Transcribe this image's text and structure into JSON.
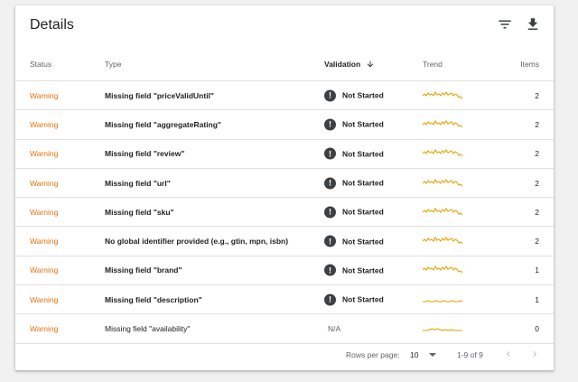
{
  "card": {
    "title": "Details",
    "filter_icon": "filter-icon",
    "download_icon": "download-icon"
  },
  "table": {
    "headers": {
      "status": "Status",
      "type": "Type",
      "validation": "Validation",
      "trend": "Trend",
      "items": "Items"
    },
    "rows": [
      {
        "status": "Warning",
        "type": "Missing field \"priceValidUntil\"",
        "validation": "Not Started",
        "items": "2"
      },
      {
        "status": "Warning",
        "type": "Missing field \"aggregateRating\"",
        "validation": "Not Started",
        "items": "2"
      },
      {
        "status": "Warning",
        "type": "Missing field \"review\"",
        "validation": "Not Started",
        "items": "2"
      },
      {
        "status": "Warning",
        "type": "Missing field \"url\"",
        "validation": "Not Started",
        "items": "2"
      },
      {
        "status": "Warning",
        "type": "Missing field \"sku\"",
        "validation": "Not Started",
        "items": "2"
      },
      {
        "status": "Warning",
        "type": "No global identifier provided (e.g., gtin, mpn, isbn)",
        "validation": "Not Started",
        "items": "2"
      },
      {
        "status": "Warning",
        "type": "Missing field \"brand\"",
        "validation": "Not Started",
        "items": "1"
      },
      {
        "status": "Warning",
        "type": "Missing field \"description\"",
        "validation": "Not Started",
        "items": "1"
      },
      {
        "status": "Warning",
        "type": "Missing field \"availability\"",
        "validation": "N/A",
        "items": "0"
      }
    ]
  },
  "footer": {
    "rows_per_page_label": "Rows per page:",
    "rows_per_page_value": "10",
    "range": "1-9 of 9"
  },
  "colors": {
    "warning": "#e8710a",
    "trend_line": "#e8a100"
  }
}
